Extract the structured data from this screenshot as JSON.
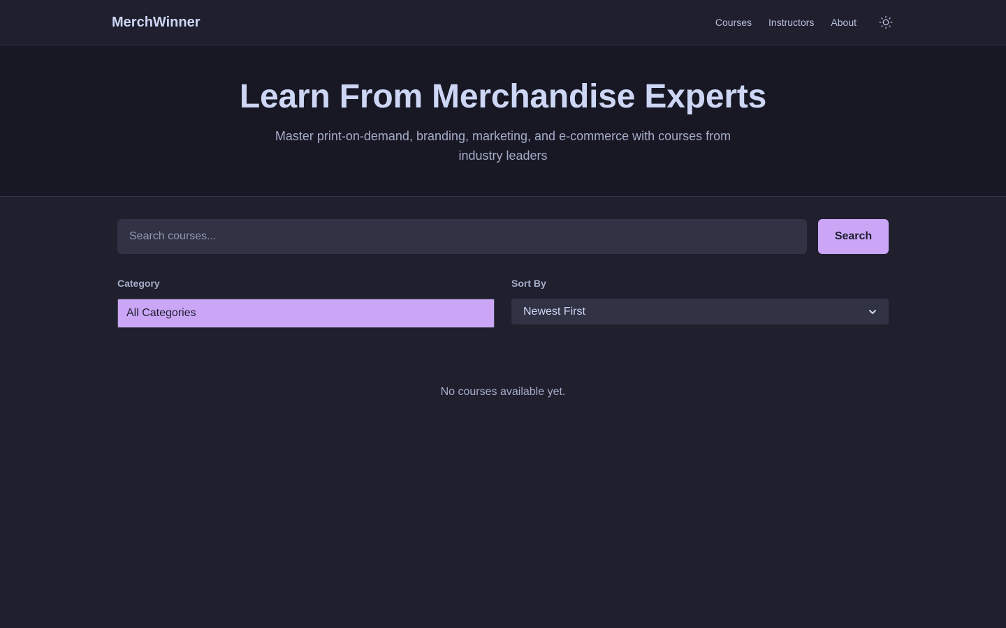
{
  "nav": {
    "brand": "MerchWinner",
    "links": [
      "Courses",
      "Instructors",
      "About"
    ],
    "theme_icon": "sun-icon"
  },
  "hero": {
    "title": "Learn From Merchandise Experts",
    "subtitle": "Master print-on-demand, branding, marketing, and e-commerce with courses from industry leaders"
  },
  "search": {
    "placeholder": "Search courses...",
    "value": "",
    "button_label": "Search"
  },
  "filters": {
    "category_label": "Category",
    "category_value": "All Categories",
    "sort_label": "Sort By",
    "sort_value": "Newest First"
  },
  "empty_message": "No courses available yet.",
  "colors": {
    "background": "#1f1f2e",
    "hero_background": "#181825",
    "accent": "#cba6f7",
    "input_background": "#313244"
  }
}
